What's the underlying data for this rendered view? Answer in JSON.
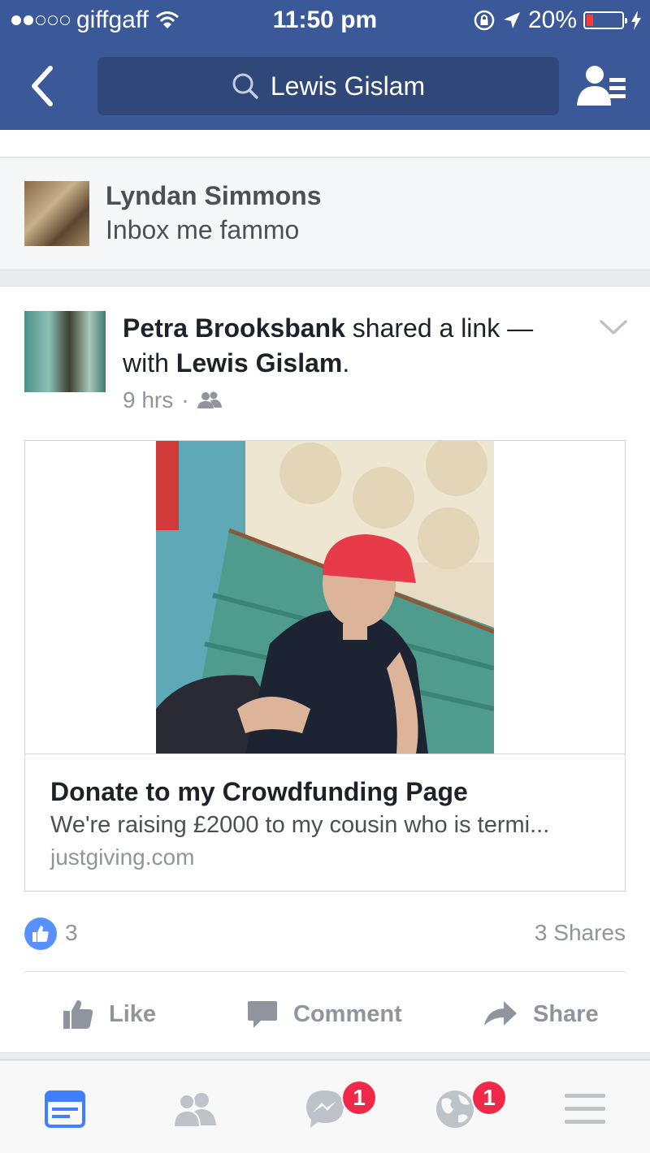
{
  "status_bar": {
    "carrier": "giffgaff",
    "time": "11:50 pm",
    "battery_percent": "20%",
    "battery_level": 0.2,
    "icons": [
      "signal-dots-icon",
      "wifi-icon",
      "rotation-lock-icon",
      "location-arrow-icon",
      "battery-icon",
      "charging-bolt-icon"
    ]
  },
  "header": {
    "search_text": "Lewis Gislam",
    "icons": [
      "back-chevron-icon",
      "search-icon",
      "friends-list-icon"
    ],
    "background_color": "#3b5998",
    "search_bg_color": "#2f4779"
  },
  "comment": {
    "author": "Lyndan Simmons",
    "text": "Inbox me fammo"
  },
  "post": {
    "author": "Petra Brooksbank",
    "action_text": " shared a link — with ",
    "tagged": "Lewis Gislam",
    "suffix": ".",
    "time": "9 hrs",
    "separator": "·",
    "audience_icon": "friends-audience-icon",
    "link": {
      "title": "Donate to my Crowdfunding Page",
      "description": "We're raising £2000 to my cousin who is termi...",
      "domain": "justgiving.com"
    },
    "like_count": "3",
    "shares": "3 Shares",
    "actions": [
      {
        "label": "Like",
        "icon": "thumbs-up-icon"
      },
      {
        "label": "Comment",
        "icon": "comment-bubble-icon"
      },
      {
        "label": "Share",
        "icon": "share-arrow-icon"
      }
    ]
  },
  "tabbar": {
    "tabs": [
      {
        "icon": "news-feed-icon",
        "active": true
      },
      {
        "icon": "friend-requests-icon",
        "active": false
      },
      {
        "icon": "messenger-icon",
        "badge": "1"
      },
      {
        "icon": "notifications-globe-icon",
        "badge": "1"
      },
      {
        "icon": "menu-icon",
        "active": false
      }
    ],
    "active_color": "#4080ff",
    "inactive_color": "#bec2c9",
    "badge_color": "#f02849"
  },
  "colors": {
    "link_blue": "#5890ff",
    "meta_gray": "#90949c"
  }
}
